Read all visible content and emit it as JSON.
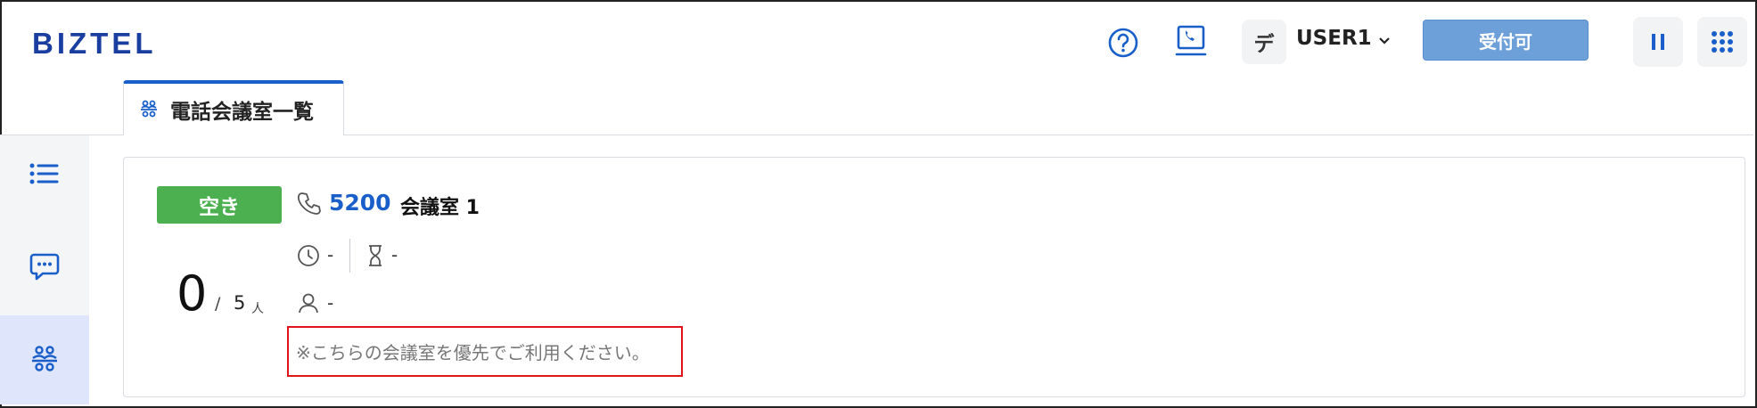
{
  "header": {
    "logo": "BIZTEL",
    "user": {
      "avatar_text": "デ",
      "name": "USER1"
    },
    "accept_button": "受付可",
    "icons": [
      "help-icon",
      "softphone-icon",
      "chevron-down-icon",
      "pause-icon",
      "apps-grid-icon"
    ]
  },
  "tabs": [
    {
      "label": "電話会議室一覧",
      "icon": "conference-icon",
      "active": true
    }
  ],
  "sidebar": {
    "items": [
      {
        "icon": "list-icon"
      },
      {
        "icon": "chat-icon"
      },
      {
        "icon": "conference-icon",
        "active": true
      }
    ]
  },
  "room": {
    "status": "空き",
    "status_color": "#4caf50",
    "extension": "5200",
    "name": "会議室 1",
    "current_count": "0",
    "separator": "/",
    "capacity": "5",
    "unit": "人",
    "elapsed": "-",
    "duration": "-",
    "host": "-",
    "note": "※こちらの会議室を優先でご利用ください。"
  },
  "colors": {
    "brand": "#1a3ea0",
    "accent": "#1a5fc9",
    "accept_button": "#6d9fd8",
    "highlight_border": "#e0141b"
  }
}
